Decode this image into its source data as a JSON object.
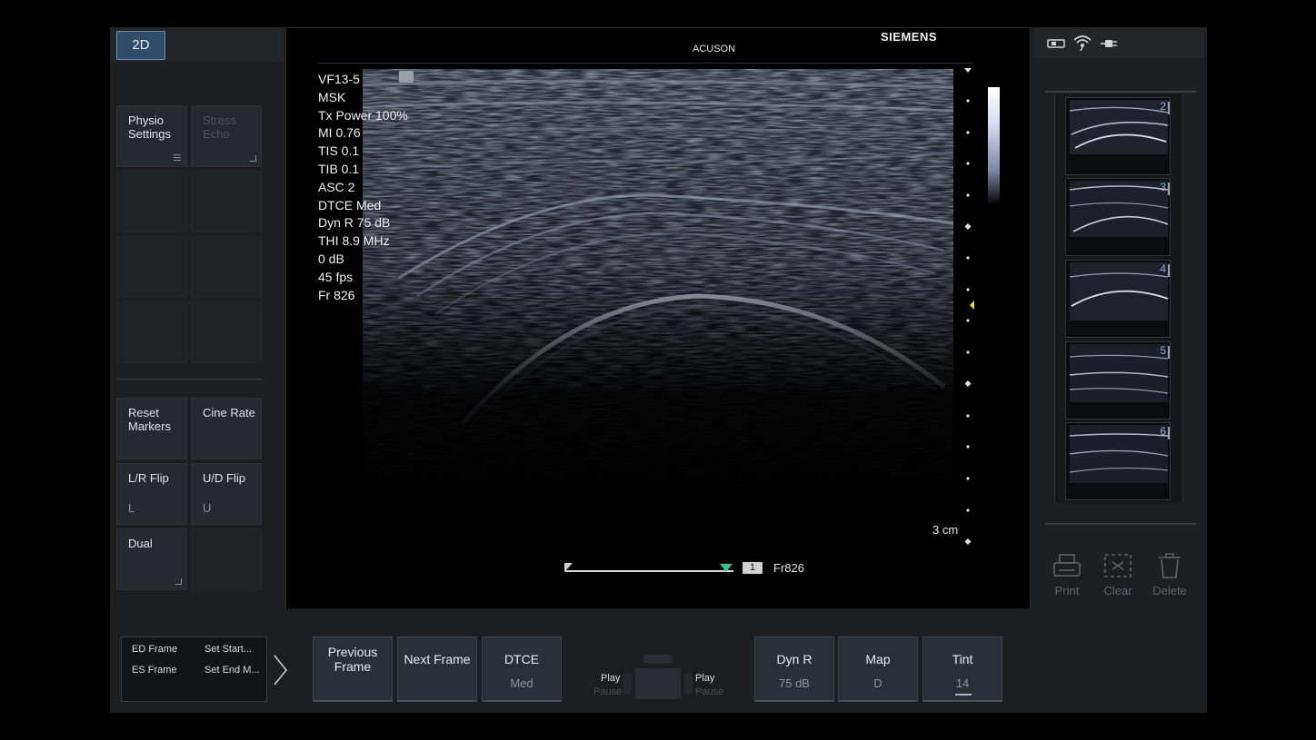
{
  "header": {
    "mode_button": "2D",
    "brand_sub": "ACUSON",
    "brand": "SIEMENS"
  },
  "left_panel": {
    "tiles": [
      {
        "label": "Physio\nSettings",
        "sub": "",
        "enabled": true
      },
      {
        "label": "Stress\nEcho",
        "sub": "",
        "enabled": false
      },
      {
        "label": "Reset\nMarkers",
        "sub": "",
        "enabled": true
      },
      {
        "label": "Cine Rate",
        "sub": "",
        "enabled": true
      },
      {
        "label": "L/R Flip",
        "sub": "L",
        "enabled": true
      },
      {
        "label": "U/D Flip",
        "sub": "U",
        "enabled": true
      },
      {
        "label": "Dual",
        "sub": "",
        "enabled": true
      }
    ]
  },
  "image": {
    "params": [
      "VF13-5",
      "MSK",
      "Tx Power 100%",
      "MI 0.76",
      "TIS 0.1",
      "TIB 0.1",
      "ASC 2",
      "DTCE Med",
      "Dyn R 75 dB",
      "THI 8.9 MHz",
      "0 dB",
      "45 fps",
      "Fr 826"
    ],
    "depth_label": "3 cm",
    "cine_badge": "1",
    "frame_readout": "Fr826"
  },
  "right_panel": {
    "thumbnails": [
      "2",
      "3",
      "4",
      "5",
      "6"
    ],
    "actions": [
      {
        "label": "Print",
        "icon": "printer-icon"
      },
      {
        "label": "Clear",
        "icon": "clear-selection-icon"
      },
      {
        "label": "Delete",
        "icon": "trash-icon"
      }
    ]
  },
  "bottom": {
    "ecg": {
      "ed_frame": "ED Frame",
      "es_frame": "ES Frame",
      "set_start": "Set Start...",
      "set_end": "Set End M..."
    },
    "buttons": [
      {
        "label": "Previous\nFrame",
        "value": ""
      },
      {
        "label": "Next Frame",
        "value": ""
      },
      {
        "label": "DTCE",
        "value": "Med"
      }
    ],
    "play_left": "Play",
    "pause_left": "Pause",
    "play_right": "Play",
    "pause_right": "Pause",
    "image_buttons": [
      {
        "label": "Dyn R",
        "value": "75 dB"
      },
      {
        "label": "Map",
        "value": "D"
      },
      {
        "label": "Tint",
        "value": "14"
      }
    ]
  },
  "colors": {
    "accent_blue": "#2f4d6b",
    "cine_marker": "#38c48a",
    "thumbnail_number": "#7fb3e3"
  }
}
